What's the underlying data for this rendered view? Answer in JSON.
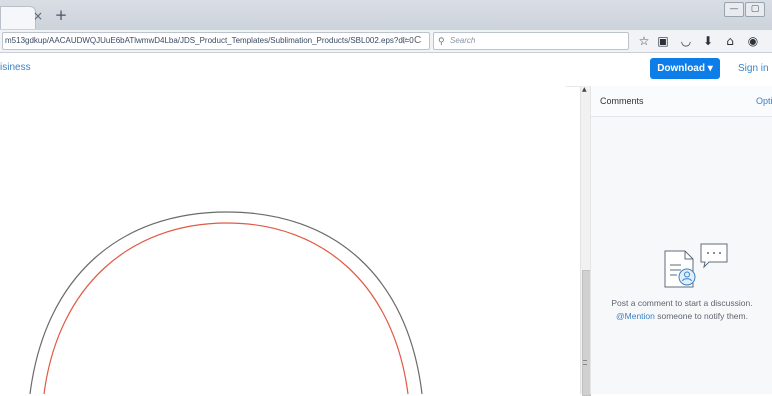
{
  "browser": {
    "tab_close": "×",
    "new_tab": "+",
    "url": "m513gdkup/AACAUDWQJUuE6bATlwmwD4Lba/JDS_Product_Templates/Sublimation_Products/SBL002.eps?dl=0",
    "search_placeholder": "Search",
    "window_controls": [
      "—",
      "▢"
    ],
    "toolbar_icons": [
      "star-icon",
      "reading-list-icon",
      "pocket-icon",
      "download-arrow-icon",
      "home-icon",
      "chat-icon"
    ]
  },
  "header": {
    "brand_text": "isiness",
    "download_label": "Download ▾",
    "sign_in_label": "Sign in"
  },
  "sidebar": {
    "title": "Comments",
    "options_label": "Opti",
    "empty_line1": "Post a comment to start a discussion.",
    "mention_label": "@Mention",
    "empty_line2_rest": " someone to notify them."
  },
  "colors": {
    "accent": "#0d7ee8",
    "link": "#3b82c4",
    "outer_arc": "#6b6b6b",
    "inner_arc": "#e05a44"
  }
}
